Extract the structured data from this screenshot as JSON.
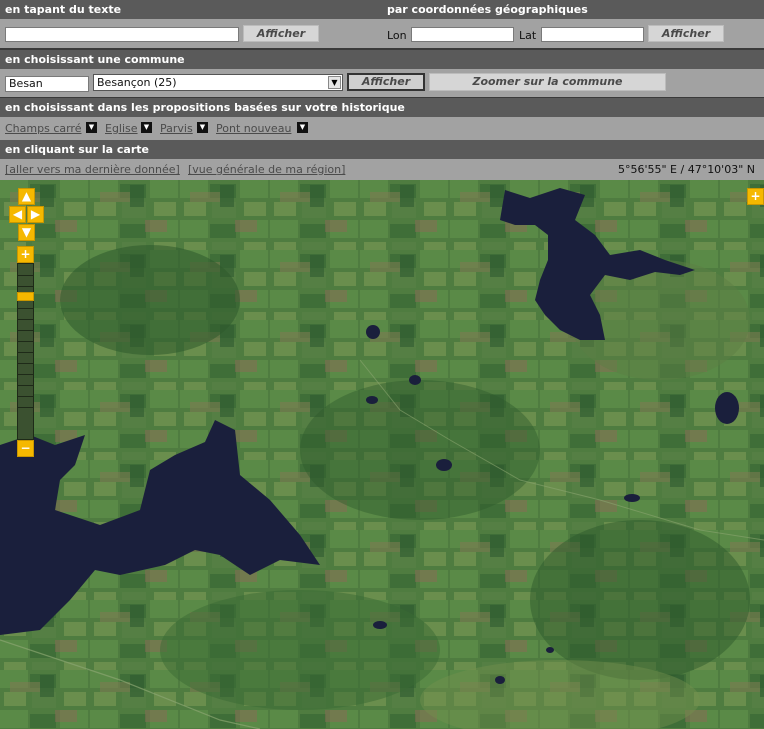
{
  "sections": {
    "text_search": {
      "title": "en tapant du texte",
      "value": "",
      "button": "Afficher"
    },
    "geo_coords": {
      "title": "par coordonnées géographiques",
      "lon_label": "Lon",
      "lat_label": "Lat",
      "lon_value": "",
      "lat_value": "",
      "button": "Afficher"
    },
    "commune": {
      "title": "en choisissant une commune",
      "input_value": "Besan",
      "select_value": "Besançon (25)",
      "button": "Afficher",
      "zoom_button": "Zoomer sur la commune"
    },
    "history": {
      "title": "en choisissant dans les propositions basées sur votre historique",
      "items": [
        "Champs carré",
        "Eglise",
        "Parvis",
        "Pont nouveau"
      ]
    },
    "map_click": {
      "title": "en cliquant sur la carte"
    }
  },
  "links": {
    "last_data": "[aller vers ma dernière donnée]",
    "region_view": "[vue générale de ma région]"
  },
  "coordinates": "5°56'55\" E / 47°10'03\" N",
  "map": {
    "controls": {
      "pan_up": "▲",
      "pan_left": "◀",
      "pan_right": "▶",
      "pan_down": "▼",
      "zoom_in": "+",
      "zoom_out": "−",
      "layer_toggle": "+"
    },
    "zoom_level_fraction": 0.17,
    "colors": {
      "land": "#4d7a3e",
      "water": "#1a1f3c",
      "control": "#f5b800"
    }
  }
}
